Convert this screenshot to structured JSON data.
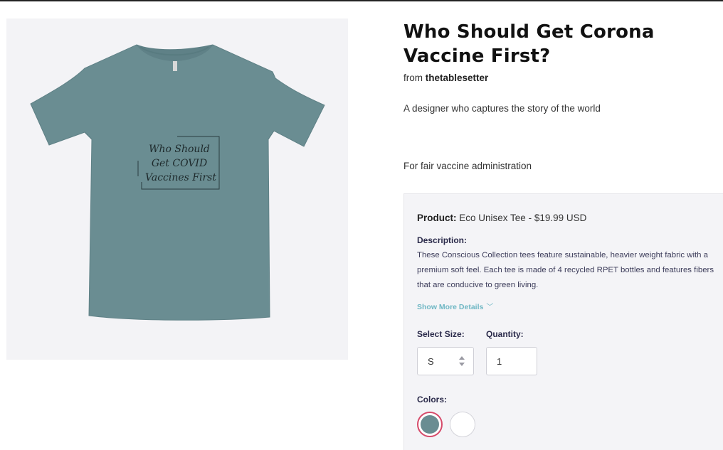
{
  "product": {
    "title": "Who Should Get Corona Vaccine First?",
    "from_prefix": "from",
    "seller": "thetablesetter",
    "tagline": "A designer who captures the story of the world",
    "subline": "For fair vaccine administration"
  },
  "shirt_print": {
    "line1": "Who Should",
    "line2": "Get COVID",
    "line3": "Vaccines First"
  },
  "details": {
    "product_label": "Product:",
    "product_value": "Eco Unisex Tee - $19.99 USD",
    "description_label": "Description:",
    "description_text": "These Conscious Collection tees feature sustainable, heavier weight fabric with a premium soft feel. Each tee is made of 4 recycled RPET bottles and features fibers that are conducive to green living.",
    "show_more": "Show More Details"
  },
  "options": {
    "size_label": "Select Size:",
    "size_value": "S",
    "quantity_label": "Quantity:",
    "quantity_value": "1",
    "colors_label": "Colors:"
  },
  "colors": {
    "shirt": "#6a8d92",
    "selected_ring": "#d64a6a",
    "accent_link": "#6fb7c4"
  }
}
